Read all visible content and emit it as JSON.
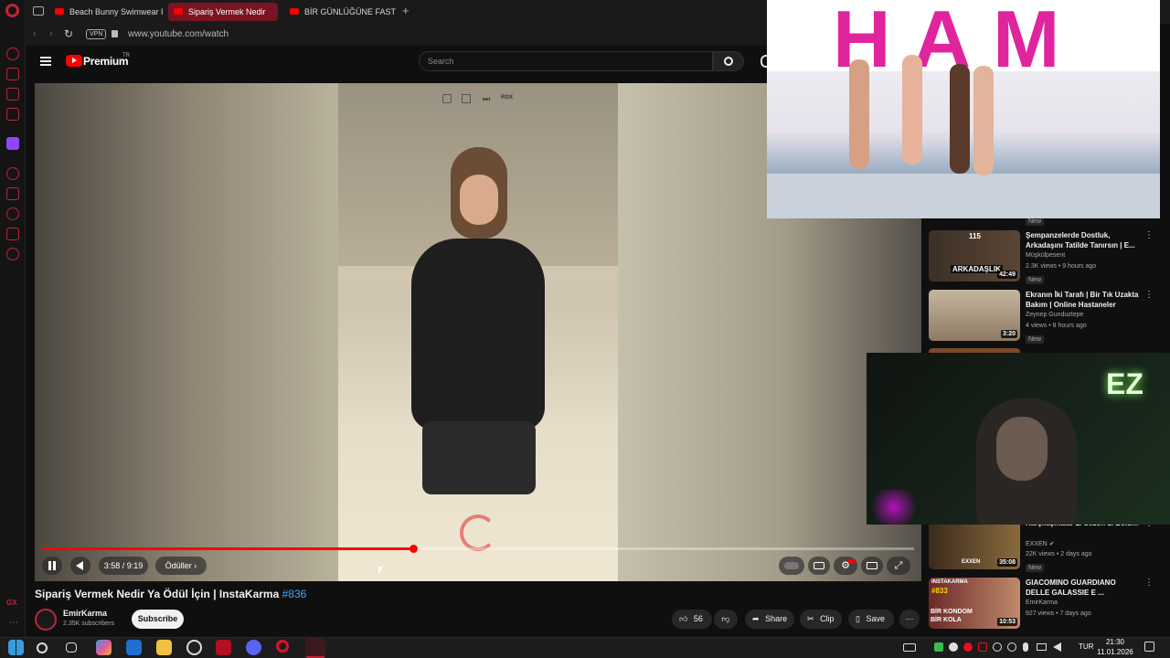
{
  "browser": {
    "tabs": [
      {
        "label": "Beach Bunny Swimwear F"
      },
      {
        "label": "Sipariş Vermek Nedir",
        "active": true
      },
      {
        "label": "BİR GÜNLÜĞÜNE FAST FO"
      }
    ],
    "new_tab_symbol": "+",
    "vpn_badge": "VPN",
    "url": "www.youtube.com/watch"
  },
  "header": {
    "logo_text": "Premium",
    "logo_superscript": "TR",
    "search_placeholder": "Search"
  },
  "video": {
    "overlay_badge": "RGX",
    "time": "3:58 / 9:19",
    "chapter_label": "Ödüller",
    "progress_fraction": 0.426,
    "title": "Sipariş Vermek Nedir Ya Ödül İçin | InstaKarma",
    "hashtag": "#836"
  },
  "channel": {
    "name": "EmirKarma",
    "subscribers": "2.35K subscribers",
    "subscribe_label": "Subscribe"
  },
  "actions": {
    "likes": "56",
    "share": "Share",
    "clip": "Clip",
    "save": "Save"
  },
  "related": [
    {
      "title": "Şempanzelerde Dostluk, Arkadaşını Tatilde Tanırsın | E...",
      "channel": "Müşkülpesent",
      "meta": "2.3K views • 9 hours ago",
      "badge": "New",
      "duration": "42:49",
      "thumb_text": "ARKADAŞLIK",
      "thumb_number": "115"
    },
    {
      "title": "Ekranın İki Tarafı | Bir Tık Uzakta Bakım | Online Hastaneler",
      "channel": "Zeynep Gunduztepe",
      "meta": "4 views • 8 hours ago",
      "badge": "New",
      "duration": "3:20"
    },
    {
      "title": "Karşılaşmalar 2. Sezon 1. Bölüm",
      "channel": "EXXEN",
      "meta": "22K views • 2 days ago",
      "badge": "New",
      "duration": "35:08",
      "thumb_text": "EXXEN"
    },
    {
      "title": "GIACOMINO GUARDIANO DELLE GALASSIE E ...",
      "channel": "EmirKarma",
      "meta": "927 views • 7 days ago",
      "badge": "",
      "duration": "10:53",
      "thumb_text": "BİR KONDOM BİR KOLA",
      "thumb_top": "INSTAKARMA",
      "thumb_number": "#833"
    }
  ],
  "overlay": {
    "pip_sign": "HAM",
    "webcam_logo": "EZ"
  },
  "taskbar": {
    "lang": "TUR",
    "time": "21:30",
    "date": "11.01.2026"
  },
  "colors": {
    "accent": "#ff0000",
    "opera": "#c0243a",
    "background": "#0f0f0f"
  }
}
